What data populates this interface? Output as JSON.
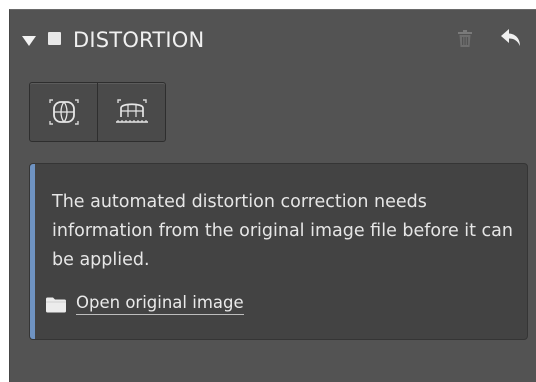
{
  "panel": {
    "title": "DISTORTION",
    "enabled": false,
    "expanded": true
  },
  "tools": [
    {
      "icon": "distortion-grid-icon"
    },
    {
      "icon": "perspective-ruler-icon"
    }
  ],
  "info": {
    "message": "The automated distortion correction needs information from the original image file before it can be applied.",
    "open_link": "Open original image"
  },
  "colors": {
    "panel_bg": "#535353",
    "info_bg": "#434343",
    "accent": "#6f93c2",
    "text": "#e6e6e6"
  }
}
